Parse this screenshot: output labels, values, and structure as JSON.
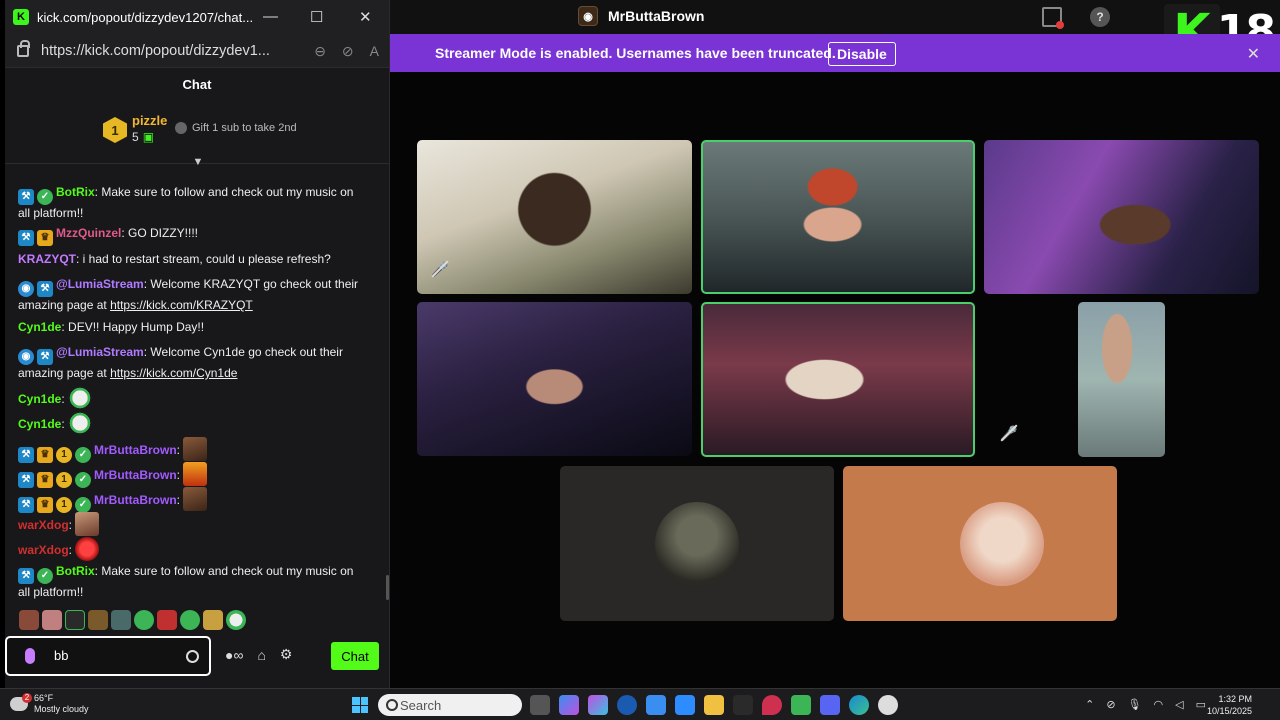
{
  "chat_window": {
    "title": "kick.com/popout/dizzydev1207/chat...",
    "url": "https://kick.com/popout/dizzydev1...",
    "header": "Chat",
    "leaderboard": {
      "rank": "1",
      "name": "pizzle",
      "count": "5",
      "gift_hint": "Gift 1 sub to take 2nd"
    },
    "messages": [
      {
        "badges": [
          "mod",
          "verified"
        ],
        "user": "BotRix",
        "color": "#53fc18",
        "text": "Make sure to follow and check out my music on all platform!!"
      },
      {
        "badges": [
          "mod",
          "crown"
        ],
        "user": "MzzQuinzel",
        "color": "#e05a8a",
        "text": "GO DIZZY!!!!"
      },
      {
        "badges": [],
        "user": "KRAZYQT",
        "color": "#c27bff",
        "text": "i had to restart stream, could u please refresh?"
      },
      {
        "badges": [
          "bot",
          "mod"
        ],
        "user": "@LumiaStream",
        "color": "#b07bff",
        "text": "Welcome KRAZYQT go check out their amazing page at ",
        "link": "https://kick.com/KRAZYQT"
      },
      {
        "badges": [],
        "user": "Cyn1de",
        "color": "#53fc18",
        "text": "DEV!! Happy Hump Day!!"
      },
      {
        "badges": [
          "bot",
          "mod"
        ],
        "user": "@LumiaStream",
        "color": "#b07bff",
        "text": "Welcome Cyn1de go check out their amazing page at ",
        "link": "https://kick.com/Cyn1de"
      },
      {
        "badges": [],
        "user": "Cyn1de",
        "color": "#53fc18",
        "text": ""
      },
      {
        "badges": [],
        "user": "Cyn1de",
        "color": "#53fc18",
        "text": ""
      },
      {
        "badges": [
          "mod",
          "crown",
          "one",
          "verified"
        ],
        "user": "MrButtaBrown",
        "color": "#a25bff",
        "text": ""
      },
      {
        "badges": [
          "mod",
          "crown",
          "one",
          "verified"
        ],
        "user": "MrButtaBrown",
        "color": "#a25bff",
        "text": ""
      },
      {
        "badges": [
          "mod",
          "crown",
          "one",
          "verified"
        ],
        "user": "MrButtaBrown",
        "color": "#a25bff",
        "text": ""
      },
      {
        "badges": [],
        "user": "warXdog",
        "color": "#d22f2f",
        "text": ""
      },
      {
        "badges": [],
        "user": "warXdog",
        "color": "#d22f2f",
        "text": ""
      },
      {
        "badges": [
          "mod",
          "verified"
        ],
        "user": "BotRix",
        "color": "#53fc18",
        "text": "Make sure to follow and check out my music on all platform!!"
      }
    ],
    "input_value": "bb",
    "chat_button": "Chat"
  },
  "main_window": {
    "title": "MrButtaBrown",
    "badge_text": "18",
    "banner": {
      "text": "Streamer Mode is enabled. Usernames have been truncated.",
      "button": "Disable"
    }
  },
  "taskbar": {
    "weather_temp": "66°F",
    "weather_desc": "Mostly cloudy",
    "weather_badge": "2",
    "search_placeholder": "Search",
    "time": "1:32 PM",
    "date": "10/15/2025"
  },
  "colors": {
    "kick_green": "#53fc18",
    "banner_purple": "#7a33d4",
    "active_tile_border": "#4ad06b"
  }
}
